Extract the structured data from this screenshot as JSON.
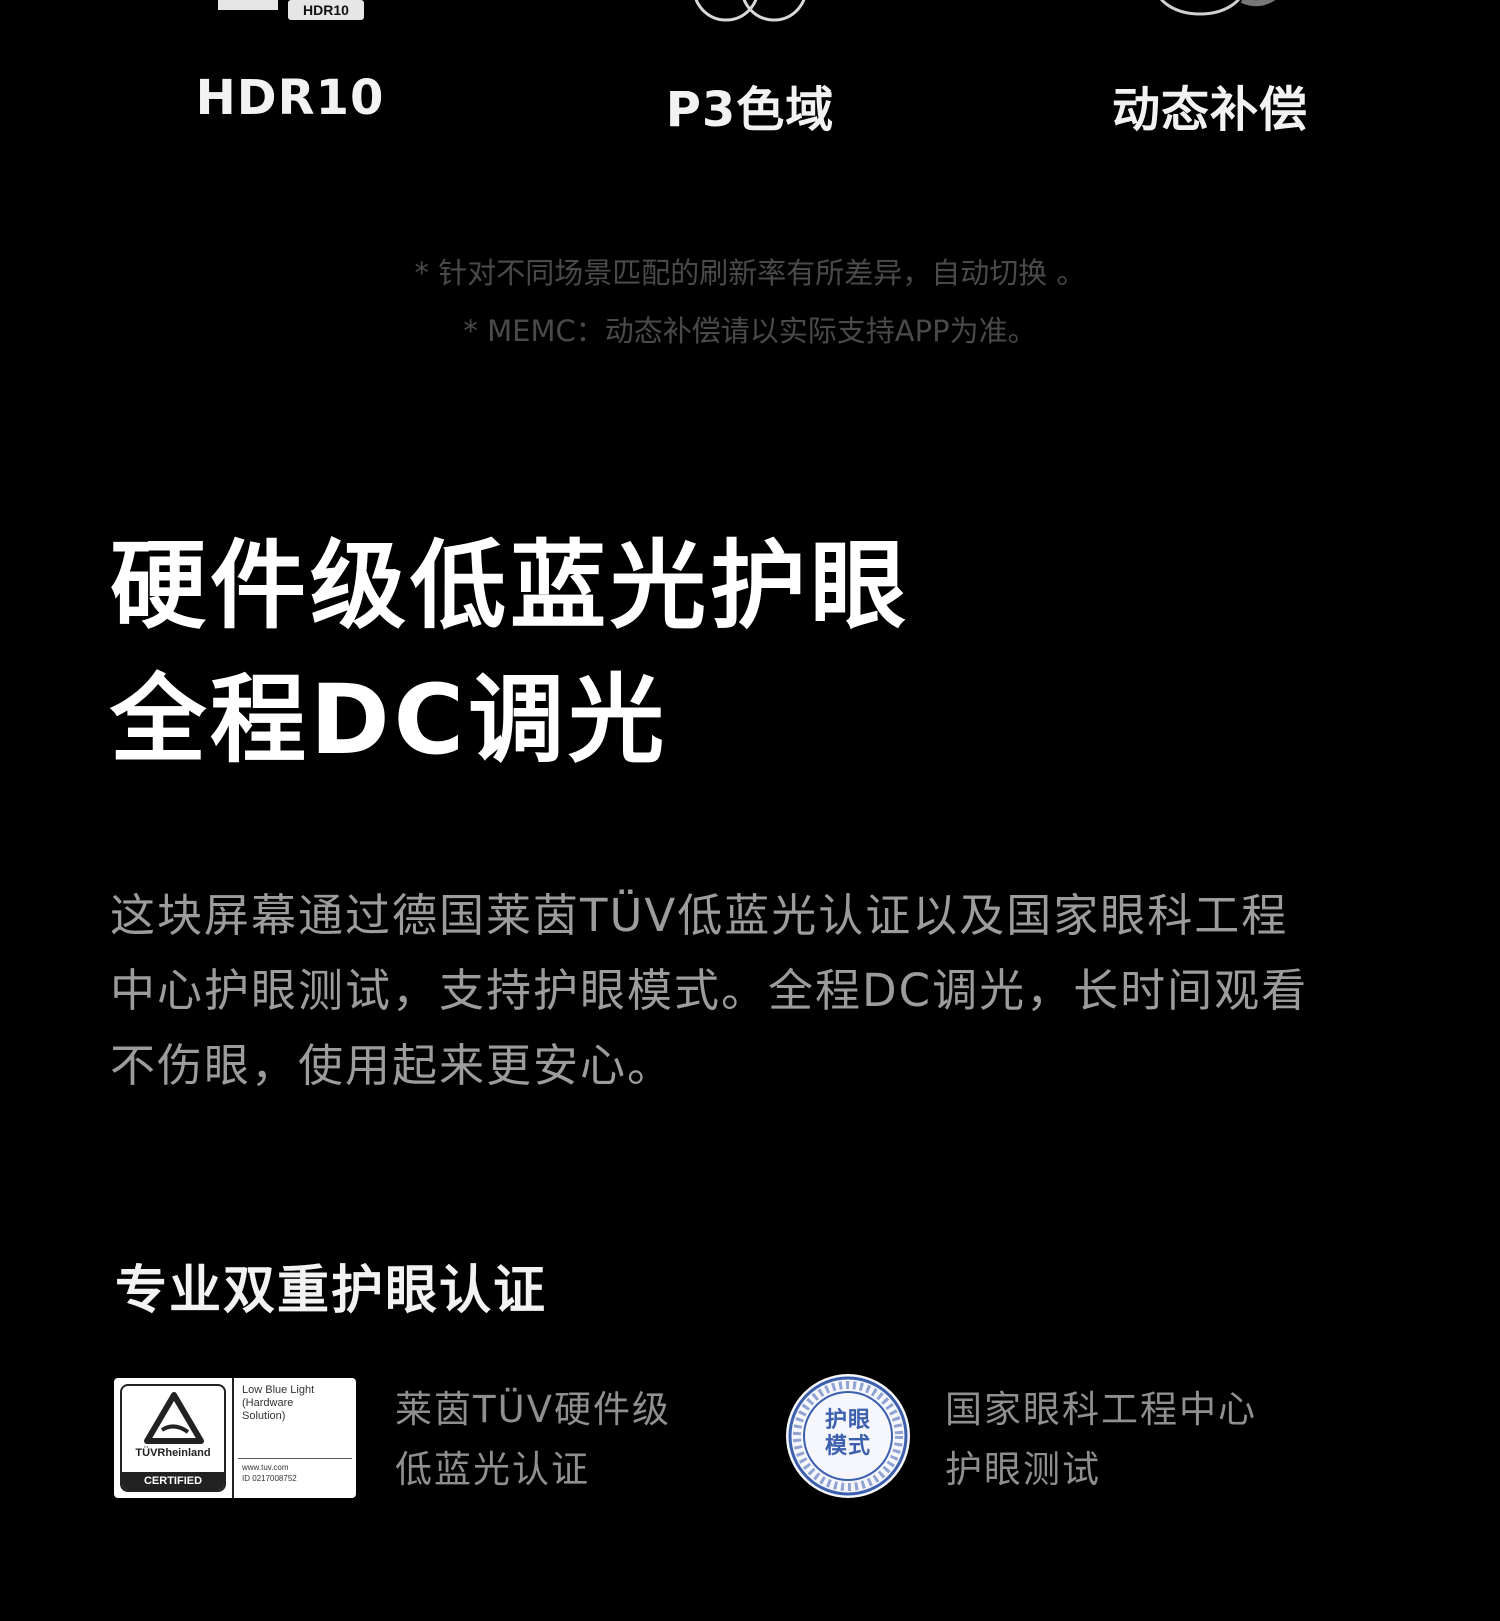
{
  "features": [
    {
      "label": "HDR10",
      "icon": "hdr10-icon",
      "icon_text": "HDR10"
    },
    {
      "label": "P3色域",
      "icon": "p3-color-gamut-icon"
    },
    {
      "label": "动态补偿",
      "icon": "motion-compensation-icon"
    }
  ],
  "footnotes": [
    "* 针对不同场景匹配的刷新率有所差异，自动切换 。",
    "* MEMC：动态补偿请以实际支持APP为准。"
  ],
  "headline": {
    "line1": "硬件级低蓝光护眼",
    "line2": "全程DC调光"
  },
  "description": {
    "line1": "这块屏幕通过德国莱茵TÜV低蓝光认证以及国家眼科工程",
    "line2": "中心护眼测试，支持护眼模式。全程DC调光，长时间观看",
    "line3": "不伤眼，使用起来更安心。"
  },
  "certification": {
    "title": "专业双重护眼认证",
    "tuv": {
      "badge_brand": "TÜVRheinland",
      "badge_certified": "CERTIFIED",
      "badge_category": [
        "Low Blue Light",
        "(Hardware",
        "Solution)"
      ],
      "badge_url": "www.tuv.com",
      "badge_id": "ID 0217008752",
      "text_line1": "莱茵TÜV硬件级",
      "text_line2": "低蓝光认证"
    },
    "national": {
      "seal_text_line1": "护眼",
      "seal_text_line2": "模式",
      "text_line1": "国家眼科工程中心",
      "text_line2": "护眼测试"
    }
  },
  "colors": {
    "background": "#000000",
    "footnote": "#4a4a4a",
    "body_text": "#9c9c9c",
    "seal_blue": "#3c5fae"
  }
}
